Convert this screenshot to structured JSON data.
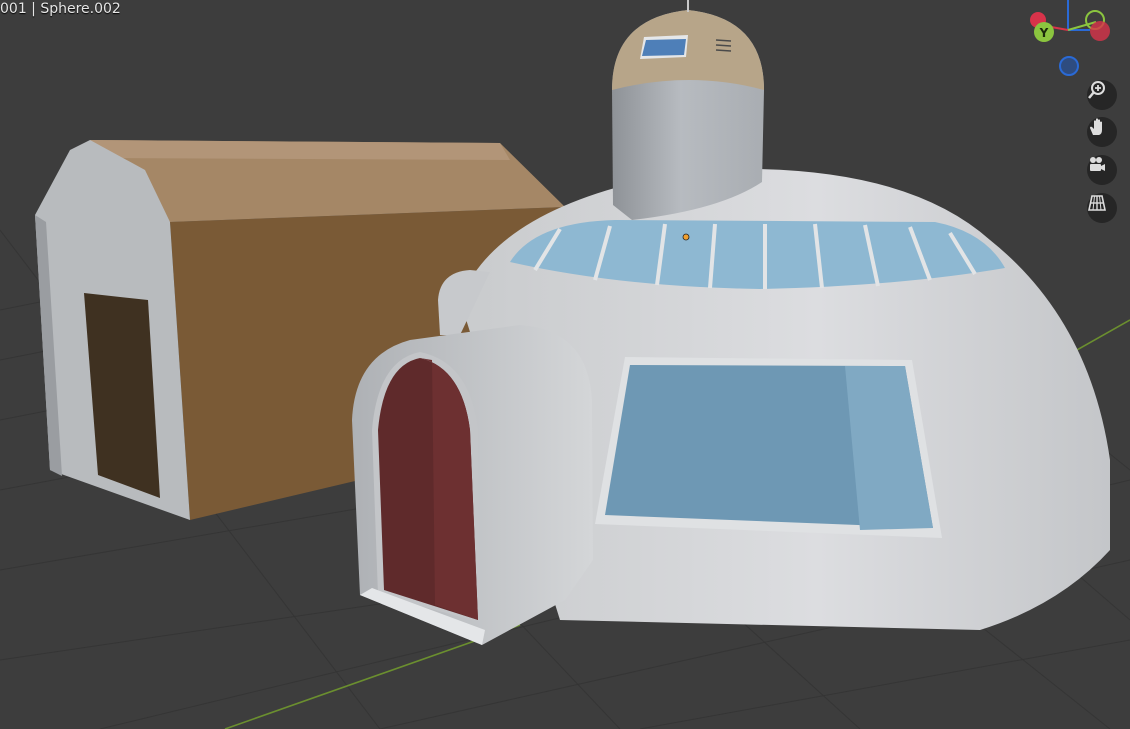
{
  "viewport": {
    "object_info": "001 | Sphere.002",
    "background_color": "#3d3d3d"
  },
  "gizmo": {
    "axes": [
      {
        "name": "X",
        "color": "#d8334a"
      },
      {
        "name": "Y",
        "color": "#8bc53f"
      },
      {
        "name": "Z",
        "color": "#2a6ad6"
      }
    ],
    "y_label": "Y"
  },
  "navigation": {
    "icons": [
      "zoom-icon",
      "hand-pan-icon",
      "camera-icon",
      "grid-icon"
    ]
  },
  "colors": {
    "barn_roof": "#a58766",
    "barn_wall": "#7a5a36",
    "dome": "#d2d4d6",
    "door_red": "#5f2a2b",
    "window_blue": "#6e98b4"
  }
}
